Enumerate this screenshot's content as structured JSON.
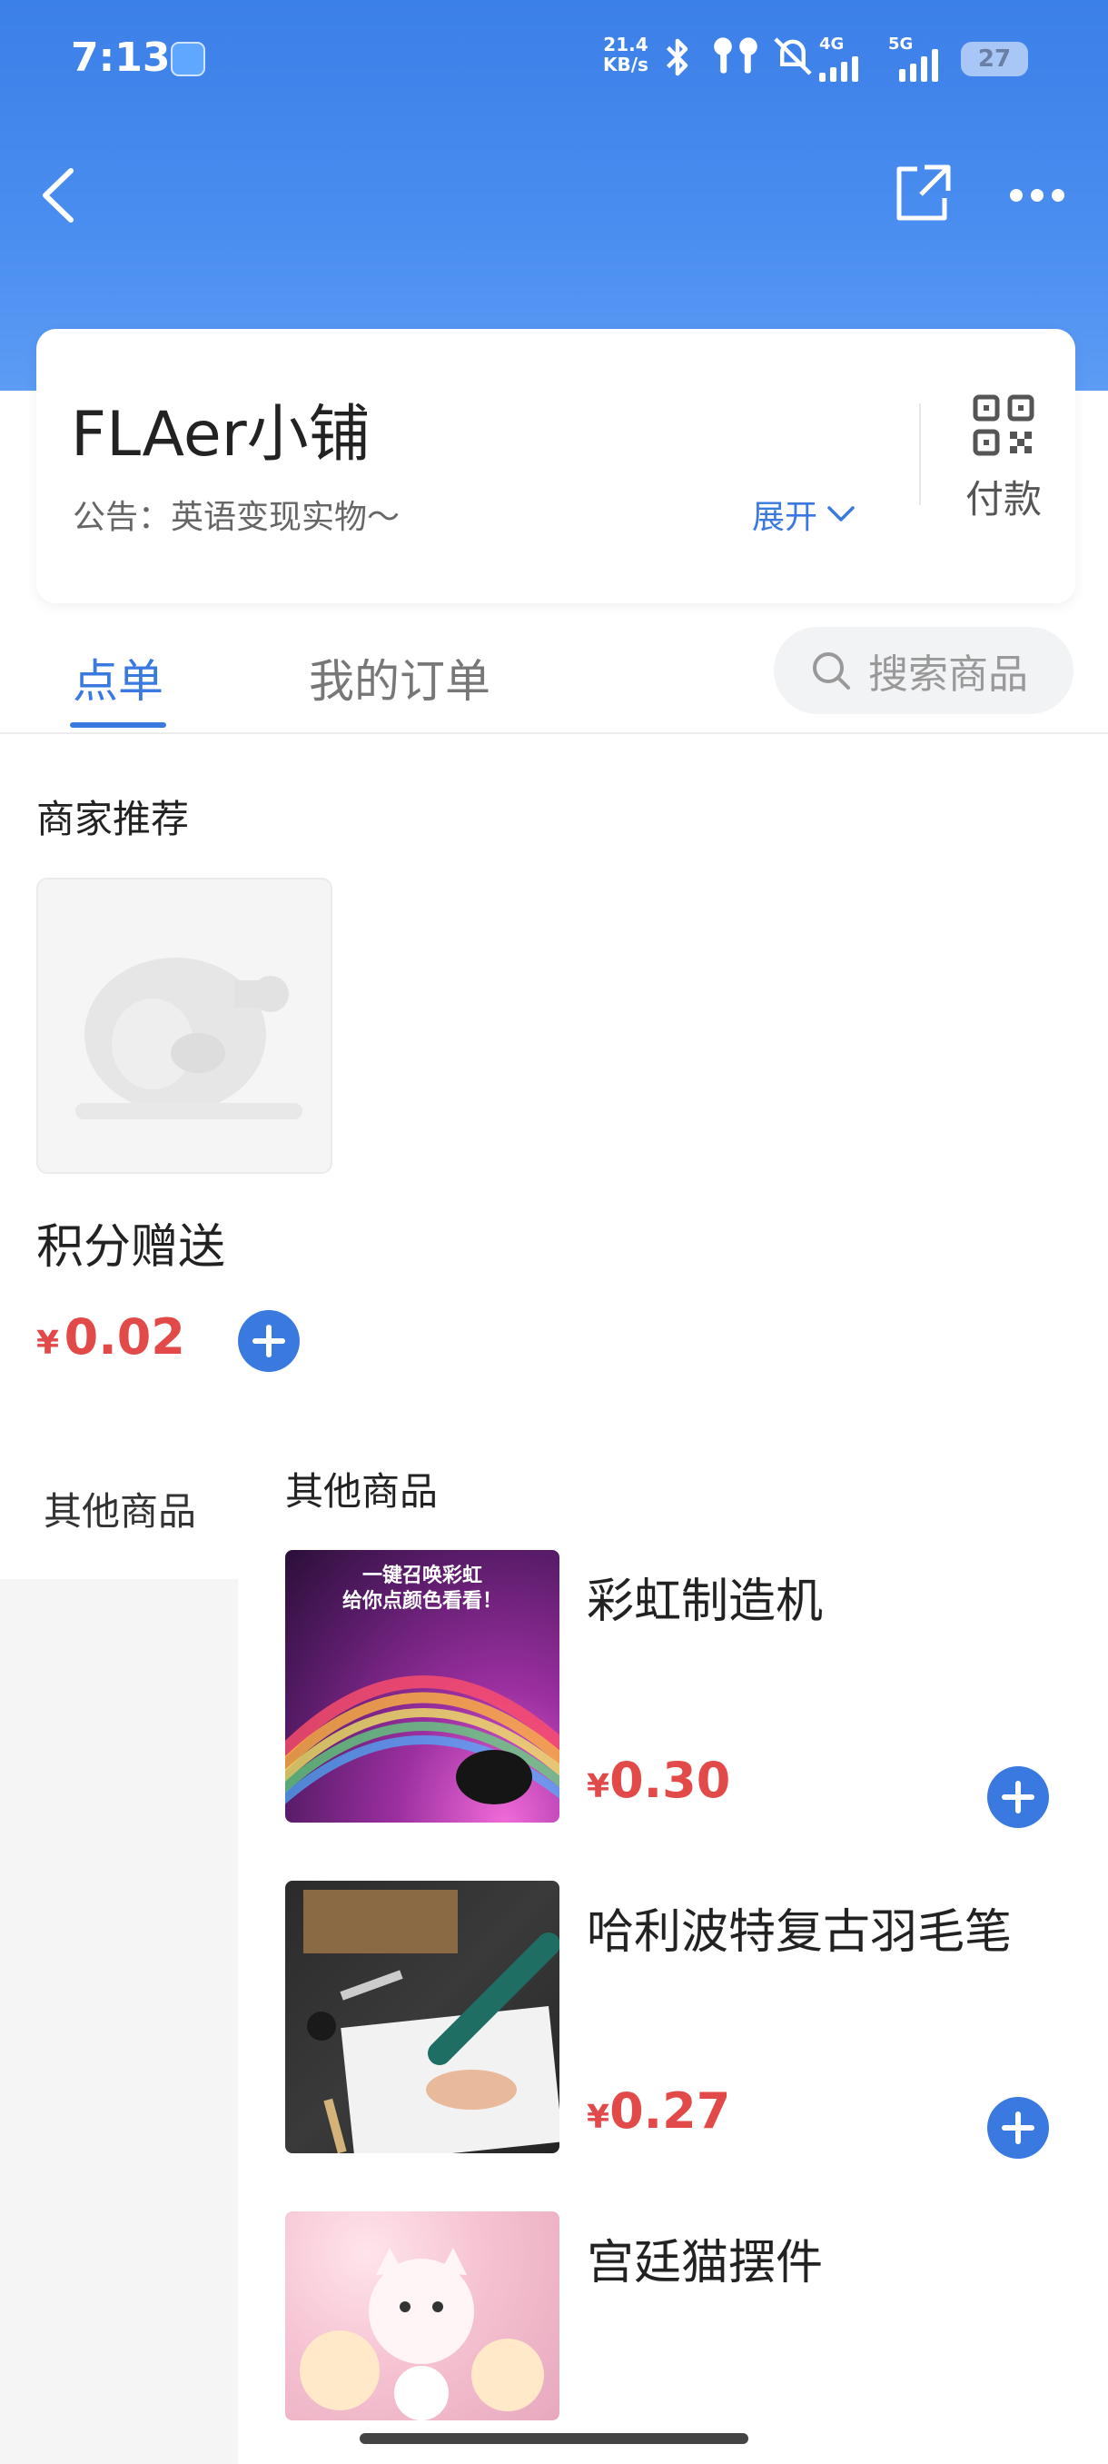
{
  "status_bar": {
    "time": "7:13",
    "net_speed_value": "21.4",
    "net_speed_unit": "KB/s",
    "sim1_label": "4G",
    "sim2_label": "5G",
    "battery": "27"
  },
  "shop": {
    "name": "FLAer小铺",
    "notice": "公告：英语变现实物～",
    "expand_label": "展开",
    "pay_label": "付款"
  },
  "tabs": {
    "order_label": "点单",
    "my_orders_label": "我的订单",
    "search_placeholder": "搜索商品"
  },
  "recommend": {
    "section_title": "商家推荐",
    "product": {
      "name": "积分赠送",
      "currency": "¥",
      "price": "0.02"
    }
  },
  "category_sidebar": {
    "items": [
      {
        "label": "其他商品",
        "active": true
      }
    ]
  },
  "product_list": {
    "title": "其他商品",
    "items": [
      {
        "name": "彩虹制造机",
        "currency": "¥",
        "price": "0.30",
        "image_text_line1": "一键召唤彩虹",
        "image_text_line2": "给你点颜色看看！"
      },
      {
        "name": "哈利波特复古羽毛笔",
        "currency": "¥",
        "price": "0.27"
      },
      {
        "name": "宫廷猫摆件"
      }
    ]
  },
  "colors": {
    "brand_blue": "#3a7ae0",
    "price_red": "#e24a4a"
  }
}
